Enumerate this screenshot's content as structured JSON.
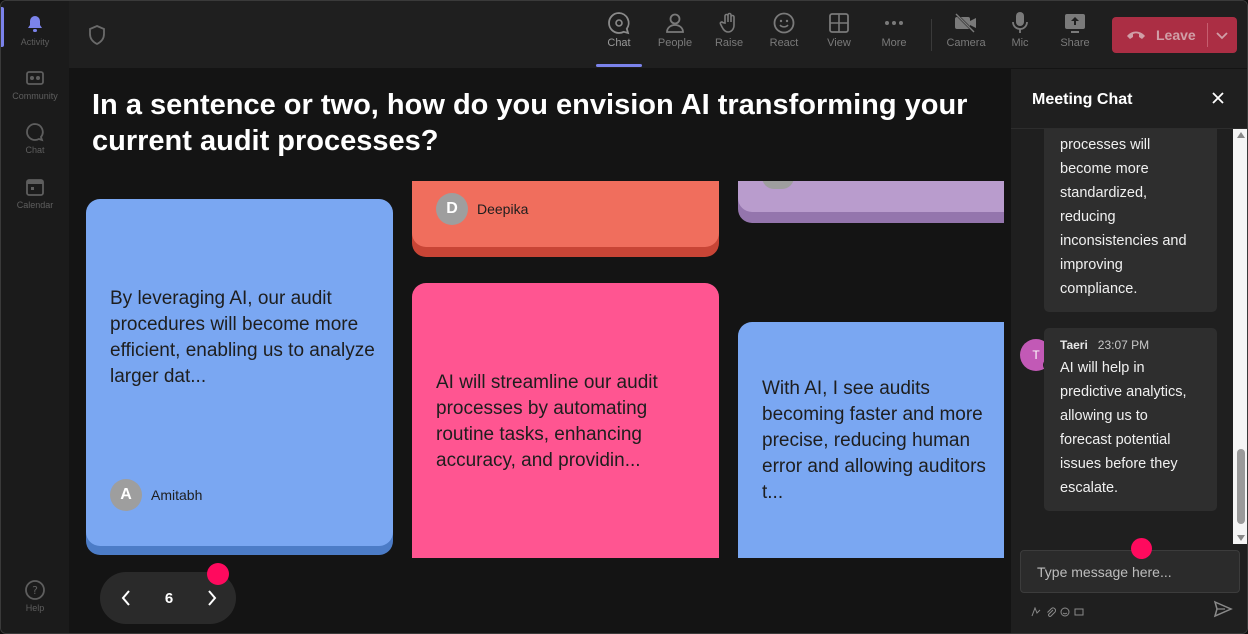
{
  "rail": {
    "items": [
      {
        "label": "Activity",
        "icon": "bell-icon"
      },
      {
        "label": "Community",
        "icon": "community-icon"
      },
      {
        "label": "Chat",
        "icon": "chat-icon"
      },
      {
        "label": "Calendar",
        "icon": "calendar-icon"
      }
    ],
    "help_label": "Help"
  },
  "toolbar": {
    "items": [
      {
        "label": "Chat",
        "icon": "chat-icon"
      },
      {
        "label": "People",
        "icon": "people-icon"
      },
      {
        "label": "Raise",
        "icon": "hand-icon"
      },
      {
        "label": "React",
        "icon": "smiley-icon"
      },
      {
        "label": "View",
        "icon": "grid-icon"
      },
      {
        "label": "More",
        "icon": "more-icon"
      },
      {
        "label": "Camera",
        "icon": "camera-off-icon"
      },
      {
        "label": "Mic",
        "icon": "mic-icon"
      },
      {
        "label": "Share",
        "icon": "share-icon"
      }
    ],
    "leave_label": "Leave",
    "accent": "#7b83eb",
    "leave_color": "#c4314b"
  },
  "main": {
    "question": "In a sentence or two, how do you envision AI transforming your current audit processes?",
    "cards": {
      "amitabh": {
        "text": "By leveraging AI, our audit procedures will become more efficient, enabling us to analyze larger dat...",
        "author": "Amitabh",
        "initial": "A",
        "color": "#7aa7f2"
      },
      "deepika": {
        "author": "Deepika",
        "initial": "D",
        "color": "#f06e5d"
      },
      "pink": {
        "text": "AI will streamline our audit processes by automating routine tasks, enhancing accuracy, and providin...",
        "color": "#ff5591"
      },
      "blue2": {
        "text": "With AI, I see audits becoming faster and more precise, reducing human error and allowing auditors t...",
        "color": "#7aa7f2"
      },
      "purple": {
        "color": "#b99ccd"
      }
    },
    "pager": {
      "page": "6"
    }
  },
  "chat": {
    "title": "Meeting Chat",
    "messages": [
      {
        "text": "processes will become more standardized, reducing inconsistencies and improving compliance."
      },
      {
        "sender": "Taeri",
        "initial": "T",
        "time": "23:07 PM",
        "text": "AI will help in predictive analytics, allowing us to forecast potential issues before they escalate."
      }
    ],
    "input_placeholder": "Type message here..."
  }
}
